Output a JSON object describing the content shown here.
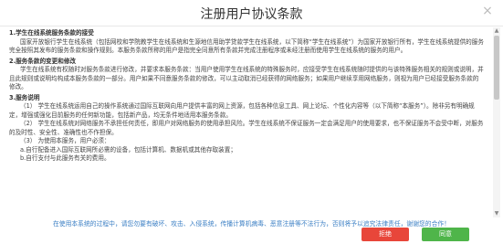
{
  "dialog": {
    "title": "注册用户协议条款",
    "close_icon": "close-icon",
    "sections": [
      {
        "title": "1.学生在线系统服务条款的接受",
        "paragraphs": [
          "国家开放银行学生在线系统（包括网校和学院教学生在线系统和生源地信用助学贷款学生在线系统，以下简称“学生在线系统”）为国家开放银行所有，学生在线系统提供的服务完全按照其发布的服务条款和操作规则。本服务条款所称的用户是指完全同意所有条款并完成注册程序或未经注册而使用学生在线系统的服务的用户。"
        ]
      },
      {
        "title": "2.服务条款的变更和修改",
        "paragraphs": [
          "学生在线系统有权随时对服务条款进行修改，并要求本服务条款：当用户使用学生在线系统的特殊服务时，应接受学生在线系统随时提供的与该特殊服务相关的规则或说明，并且此规则或说明均构成本服务条款的一部分。用户如果不同意服务条款的修改，可以主动取消已经获得的网络服务；如果用户继续享用网络服务，则视为用户已经接受服务条款的修改。"
        ]
      },
      {
        "title": "3.服务说明",
        "paragraphs": [
          "（1） 学生在线系统运用自己的操作系统通过国际互联网向用户提供丰富的网上资源，包括各种信息工具、网上论坛、个性化内容等（以下简称“本服务”）。除非另有明确规定，增强或强化目前服务的任何新功能，包括新产品，均无条件地适用本服务条款。",
          "（2） 学生在线系统对网络服务不承担任何责任，即用户对网络服务的使用承担风险。学生在线系统不保证服务一定会满足用户的使用要求，也不保证服务不会受中断，对服务的及时性、安全性、准确性也不作担保。",
          "（3） 为使用本服务，用户必须：",
          "a.自行配备进入国际互联网所必需的设备，包括计算机、数据机或其他存取装置；",
          "b.自行支付与此服务有关的费用。"
        ]
      }
    ],
    "notice": "在使用本系统的过程中，请您勿要有破坏、攻击、入侵系统，传播计算机病毒、恶意注册等不法行为，否则将予以追究法律责任，谢谢您的合作！",
    "reject_label": "拒绝",
    "agree_label": "同意",
    "colors": {
      "notice": "#3b7fc4",
      "reject": "#e8463a",
      "agree": "#4fb54a"
    }
  }
}
